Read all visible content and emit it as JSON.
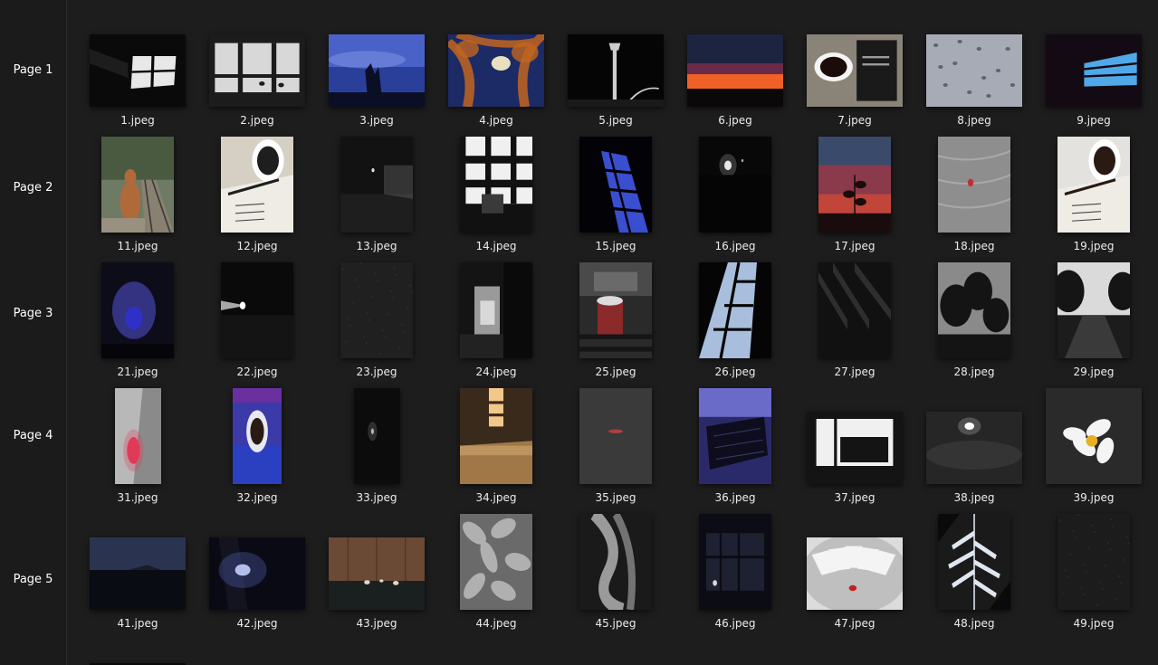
{
  "sidebar": {
    "pages": [
      "Page 1",
      "Page 2",
      "Page 3",
      "Page 4",
      "Page 5"
    ]
  },
  "grid": {
    "rows": [
      [
        {
          "name": "1.jpeg",
          "w": 106,
          "h": 80,
          "bg": "#0a0a0a",
          "fg": "#e8e8e8",
          "motif": "window-light"
        },
        {
          "name": "2.jpeg",
          "w": 106,
          "h": 80,
          "bg": "#d8d8d8",
          "fg": "#1c1c1c",
          "motif": "arches"
        },
        {
          "name": "3.jpeg",
          "w": 106,
          "h": 80,
          "bg": "#2a3f9a",
          "fg": "#0b0f25",
          "motif": "sky-hand"
        },
        {
          "name": "4.jpeg",
          "w": 106,
          "h": 80,
          "bg": "#1c2a66",
          "fg": "#c2651e",
          "motif": "tree-moon"
        },
        {
          "name": "5.jpeg",
          "w": 106,
          "h": 80,
          "bg": "#050505",
          "fg": "#cfcfcf",
          "motif": "lamp"
        },
        {
          "name": "6.jpeg",
          "w": 106,
          "h": 80,
          "bg": "#2a1216",
          "fg": "#f0612a",
          "motif": "sunset"
        },
        {
          "name": "7.jpeg",
          "w": 106,
          "h": 80,
          "bg": "#8a8478",
          "fg": "#1a1a1a",
          "motif": "cup-book"
        },
        {
          "name": "8.jpeg",
          "w": 106,
          "h": 80,
          "bg": "#a7abb6",
          "fg": "#5e6470",
          "motif": "raindrops"
        },
        {
          "name": "9.jpeg",
          "w": 106,
          "h": 80,
          "bg": "#140a14",
          "fg": "#4fa8e8",
          "motif": "blue-window"
        }
      ],
      [
        {
          "name": "11.jpeg",
          "w": 80,
          "h": 106,
          "bg": "#6f7a64",
          "fg": "#b06a3a",
          "motif": "dog-track"
        },
        {
          "name": "12.jpeg",
          "w": 80,
          "h": 106,
          "bg": "#d6d0c4",
          "fg": "#1e1e1e",
          "motif": "cup-notes"
        },
        {
          "name": "13.jpeg",
          "w": 80,
          "h": 106,
          "bg": "#121212",
          "fg": "#6a6a6a",
          "motif": "night-street"
        },
        {
          "name": "14.jpeg",
          "w": 80,
          "h": 106,
          "bg": "#f0f0f0",
          "fg": "#111111",
          "motif": "grid-window"
        },
        {
          "name": "15.jpeg",
          "w": 80,
          "h": 106,
          "bg": "#030307",
          "fg": "#3a4ed0",
          "motif": "blue-grid"
        },
        {
          "name": "16.jpeg",
          "w": 80,
          "h": 106,
          "bg": "#080808",
          "fg": "#e8e8e8",
          "motif": "night-light"
        },
        {
          "name": "17.jpeg",
          "w": 80,
          "h": 106,
          "bg": "#c2453a",
          "fg": "#1a0c0c",
          "motif": "red-plant"
        },
        {
          "name": "18.jpeg",
          "w": 80,
          "h": 106,
          "bg": "#8e8e8e",
          "fg": "#c03030",
          "motif": "sand-red"
        },
        {
          "name": "19.jpeg",
          "w": 80,
          "h": 106,
          "bg": "#e4e2de",
          "fg": "#2a1a14",
          "motif": "cup-notes"
        }
      ],
      [
        {
          "name": "21.jpeg",
          "w": 80,
          "h": 106,
          "bg": "#0d0d1a",
          "fg": "#5a5ae8",
          "motif": "purple-glow"
        },
        {
          "name": "22.jpeg",
          "w": 80,
          "h": 106,
          "bg": "#0a0a0a",
          "fg": "#cfcfcf",
          "motif": "beam"
        },
        {
          "name": "23.jpeg",
          "w": 80,
          "h": 106,
          "bg": "#202020",
          "fg": "#2c2c2c",
          "motif": "gravel"
        },
        {
          "name": "24.jpeg",
          "w": 80,
          "h": 106,
          "bg": "#141414",
          "fg": "#9a9a9a",
          "motif": "doorway"
        },
        {
          "name": "25.jpeg",
          "w": 80,
          "h": 106,
          "bg": "#2a2a2a",
          "fg": "#8a2a2a",
          "motif": "cup-rail"
        },
        {
          "name": "26.jpeg",
          "w": 80,
          "h": 106,
          "bg": "#050505",
          "fg": "#a8bedc",
          "motif": "diagonal-window"
        },
        {
          "name": "27.jpeg",
          "w": 80,
          "h": 106,
          "bg": "#111111",
          "fg": "#2e2e2e",
          "motif": "shadows"
        },
        {
          "name": "28.jpeg",
          "w": 80,
          "h": 106,
          "bg": "#8a8a8a",
          "fg": "#141414",
          "motif": "trees"
        },
        {
          "name": "29.jpeg",
          "w": 80,
          "h": 106,
          "bg": "#dadada",
          "fg": "#151515",
          "motif": "trees-road"
        }
      ],
      [
        {
          "name": "31.jpeg",
          "w": 51,
          "h": 106,
          "bg": "#b8b8b8",
          "fg": "#e03a5a",
          "motif": "pink-flower"
        },
        {
          "name": "32.jpeg",
          "w": 54,
          "h": 106,
          "bg": "#3b3aa8",
          "fg": "#e8e8f0",
          "motif": "blue-cup"
        },
        {
          "name": "33.jpeg",
          "w": 51,
          "h": 106,
          "bg": "#0c0c0c",
          "fg": "#b8b8b8",
          "motif": "night-moon"
        },
        {
          "name": "34.jpeg",
          "w": 80,
          "h": 106,
          "bg": "#3a2a1c",
          "fg": "#f2c88a",
          "motif": "warm-room"
        },
        {
          "name": "35.jpeg",
          "w": 80,
          "h": 106,
          "bg": "#3a3a3a",
          "fg": "#b04040",
          "motif": "flat-gray"
        },
        {
          "name": "36.jpeg",
          "w": 80,
          "h": 106,
          "bg": "#2a2a6a",
          "fg": "#0d0d1e",
          "motif": "keyboard"
        },
        {
          "name": "37.jpeg",
          "w": 106,
          "h": 80,
          "bg": "#f0f0f0",
          "fg": "#141414",
          "motif": "piano-room"
        },
        {
          "name": "38.jpeg",
          "w": 106,
          "h": 80,
          "bg": "#262626",
          "fg": "#ffffff",
          "motif": "cloud-moon"
        },
        {
          "name": "39.jpeg",
          "w": 106,
          "h": 106,
          "bg": "#2a2a2a",
          "fg": "#f4f4f4",
          "motif": "frangipani"
        }
      ],
      [
        {
          "name": "41.jpeg",
          "w": 106,
          "h": 80,
          "bg": "#1a2030",
          "fg": "#0a0c14",
          "motif": "lake-night"
        },
        {
          "name": "42.jpeg",
          "w": 106,
          "h": 80,
          "bg": "#0a0a14",
          "fg": "#d8e0f8",
          "motif": "blue-flare"
        },
        {
          "name": "43.jpeg",
          "w": 106,
          "h": 80,
          "bg": "#6a4a34",
          "fg": "#1a2020",
          "motif": "wood-floor"
        },
        {
          "name": "44.jpeg",
          "w": 80,
          "h": 106,
          "bg": "#6a6a6a",
          "fg": "#b0b0b0",
          "motif": "leaves"
        },
        {
          "name": "45.jpeg",
          "w": 80,
          "h": 106,
          "bg": "#1a1a1a",
          "fg": "#9a9a9a",
          "motif": "rope"
        },
        {
          "name": "46.jpeg",
          "w": 80,
          "h": 106,
          "bg": "#0c0c14",
          "fg": "#3a4060",
          "motif": "dark-window"
        },
        {
          "name": "47.jpeg",
          "w": 106,
          "h": 80,
          "bg": "#dcdcdc",
          "fg": "#c02020",
          "motif": "cards"
        },
        {
          "name": "48.jpeg",
          "w": 80,
          "h": 106,
          "bg": "#1a1a1a",
          "fg": "#dfe6ee",
          "motif": "fern"
        },
        {
          "name": "49.jpeg",
          "w": 80,
          "h": 106,
          "bg": "#1c1c1c",
          "fg": "#2a2a2a",
          "motif": "gravel"
        }
      ]
    ]
  }
}
